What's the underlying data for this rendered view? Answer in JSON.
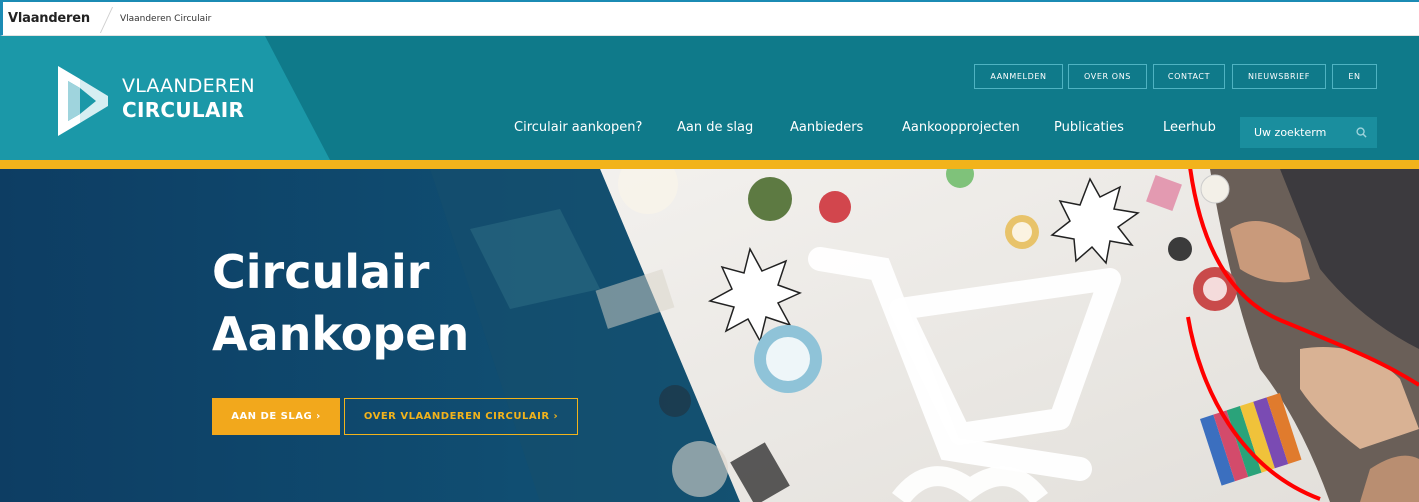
{
  "topbar": {
    "brand": "Vlaanderen",
    "breadcrumb": "Vlaanderen Circulair"
  },
  "logo": {
    "line1": "VLAANDEREN",
    "line2": "CIRCULAIR"
  },
  "utility_nav": [
    {
      "label": "AANMELDEN"
    },
    {
      "label": "OVER ONS"
    },
    {
      "label": "CONTACT"
    },
    {
      "label": "NIEUWSBRIEF"
    },
    {
      "label": "EN"
    }
  ],
  "main_nav": [
    {
      "label": "Circulair aankopen?"
    },
    {
      "label": "Aan de slag"
    },
    {
      "label": "Aanbieders"
    },
    {
      "label": "Aankoopprojecten"
    },
    {
      "label": "Publicaties"
    },
    {
      "label": "Leerhub"
    }
  ],
  "search": {
    "placeholder": "Uw zoekterm",
    "icon": "search-icon"
  },
  "hero": {
    "title_line1": "Circulair",
    "title_line2": "Aankopen",
    "primary_button": "AAN DE SLAG ›",
    "secondary_button": "OVER VLAANDEREN CIRCULAIR ›"
  },
  "colors": {
    "header_bg": "#0f7a8a",
    "logo_panel": "#1b98a8",
    "accent_yellow": "#f2b31b",
    "button_orange": "#f2a81c",
    "hero_dark": "#0e4a6e",
    "annotation_red": "#ff0000"
  }
}
